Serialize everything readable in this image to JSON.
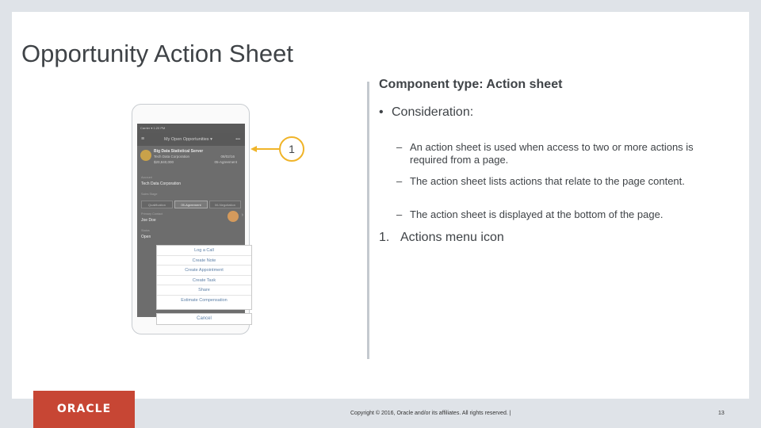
{
  "slide": {
    "title": "Opportunity Action Sheet"
  },
  "right": {
    "component_type": "Component type: Action sheet",
    "consideration_bullet": "•",
    "consideration": "Consideration:",
    "sub_bullets": [
      {
        "dash": "–",
        "text": "An action sheet is used when access to two or more actions is required from a page."
      },
      {
        "dash": "–",
        "text": "The action sheet lists actions that relate to the page content."
      },
      {
        "dash": "–",
        "text": "The action sheet is displayed at the bottom of the page."
      }
    ],
    "numbered_index": "1.",
    "numbered_text": "Actions menu icon"
  },
  "callout": {
    "number": "1",
    "color": "#f0b429"
  },
  "phone": {
    "status_text": "Carrier ▾          1:20 PM",
    "hamburger": "≡",
    "appbar_title": "My Open Opportunities",
    "appbar_caret": "▾",
    "actions_icon": "•••",
    "card": {
      "name": "Big Data Statistical Server",
      "company": "Tech Data Corporation",
      "amount": "$20,840,000",
      "date": "08/02/16",
      "stage": "05-Agreement"
    },
    "account_label": "Account",
    "account_value": "Tech Data Corporation",
    "sales_stage_label": "Sales Stage",
    "stages": [
      "Qualification",
      "05-Agreement",
      "06-Negotiation"
    ],
    "owner_label": "Primary Contact",
    "owner_value": "Joe Doe",
    "status_label": "Status",
    "status_value": "Open",
    "chevron": "›"
  },
  "action_sheet": {
    "items": [
      "Log a Call",
      "Create Note",
      "Create Appointment",
      "Create Task",
      "Share",
      "Estimate Compensation"
    ],
    "cancel": "Cancel"
  },
  "footer": {
    "logo_text": "ORACLE",
    "copyright": "Copyright © 2016, Oracle and/or its affiliates. All rights reserved.  |",
    "page_number": "13"
  },
  "colors": {
    "brand_red": "#c74634",
    "accent_yellow": "#f0b429",
    "text_dark": "#3f4347"
  }
}
